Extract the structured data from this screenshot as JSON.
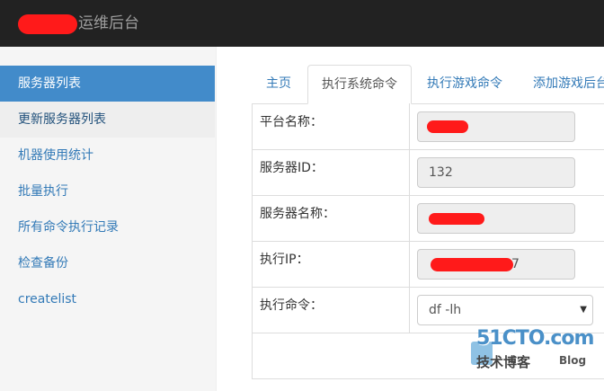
{
  "navbar": {
    "brand": "运维后台"
  },
  "sidebar": {
    "items": [
      {
        "label": "服务器列表"
      },
      {
        "label": "更新服务器列表"
      },
      {
        "label": "机器使用统计"
      },
      {
        "label": "批量执行"
      },
      {
        "label": "所有命令执行记录"
      },
      {
        "label": "检查备份"
      },
      {
        "label": "createlist"
      }
    ]
  },
  "tabs": [
    {
      "label": "主页"
    },
    {
      "label": "执行系统命令"
    },
    {
      "label": "执行游戏命令"
    },
    {
      "label": "添加游戏后台"
    }
  ],
  "form": {
    "platform_label": "平台名称：",
    "server_id_label": "服务器ID：",
    "server_id_value": "132",
    "server_name_label": "服务器名称：",
    "exec_ip_label": "执行IP：",
    "exec_ip_suffix": "7",
    "command_label": "执行命令：",
    "command_value": "df -lh"
  },
  "watermark": {
    "site": "51CTO.com",
    "sub": "技术博客",
    "blog": "Blog"
  },
  "colors": {
    "navbar_bg": "#222222",
    "accent": "#428bca",
    "link": "#337ab7",
    "redaction": "#ff1a1a"
  }
}
